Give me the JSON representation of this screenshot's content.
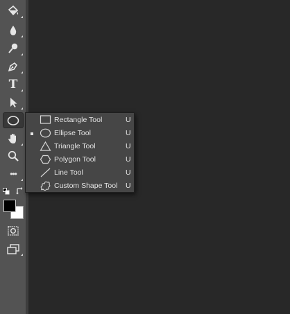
{
  "colors": {
    "toolbar": "#535353",
    "canvas": "#282828",
    "flyout": "#464646",
    "text": "#e3e3e3",
    "foreground_swatch": "#000000",
    "background_swatch": "#ffffff"
  },
  "toolbar": {
    "tools": [
      {
        "name": "paint-bucket-tool",
        "icon": "paint-bucket-icon"
      },
      {
        "name": "blur-tool",
        "icon": "drop-icon"
      },
      {
        "name": "dodge-tool",
        "icon": "dodge-icon"
      },
      {
        "name": "pen-tool",
        "icon": "pen-icon"
      },
      {
        "name": "type-tool",
        "icon": "type-icon",
        "glyph": "T"
      },
      {
        "name": "path-selection-tool",
        "icon": "arrow-pointer-icon"
      },
      {
        "name": "ellipse-tool",
        "icon": "ellipse-icon",
        "active": true
      },
      {
        "name": "hand-tool",
        "icon": "hand-icon"
      },
      {
        "name": "zoom-tool",
        "icon": "magnifier-icon"
      },
      {
        "name": "edit-toolbar",
        "icon": "more-dots-icon",
        "glyph": "•••"
      },
      {
        "name": "quick-mask",
        "icon": "quick-mask-icon"
      },
      {
        "name": "screen-mode",
        "icon": "screen-mode-icon"
      }
    ]
  },
  "flyout": {
    "items": [
      {
        "label": "Rectangle Tool",
        "shortcut": "U",
        "icon": "rectangle-icon",
        "selected": false
      },
      {
        "label": "Ellipse Tool",
        "shortcut": "U",
        "icon": "ellipse-icon",
        "selected": true
      },
      {
        "label": "Triangle Tool",
        "shortcut": "U",
        "icon": "triangle-icon",
        "selected": false
      },
      {
        "label": "Polygon Tool",
        "shortcut": "U",
        "icon": "polygon-icon",
        "selected": false
      },
      {
        "label": "Line Tool",
        "shortcut": "U",
        "icon": "line-icon",
        "selected": false
      },
      {
        "label": "Custom Shape Tool",
        "shortcut": "U",
        "icon": "custom-shape-icon",
        "selected": false
      }
    ]
  }
}
